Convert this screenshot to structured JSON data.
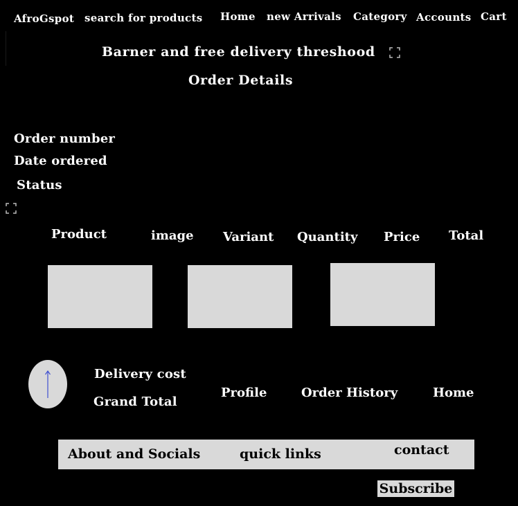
{
  "nav": {
    "logo": "AfroGspot",
    "search": "search for products",
    "items": [
      "Home",
      "new Arrivals",
      "Category",
      "Accounts",
      "Cart"
    ]
  },
  "banner": "Barner and free delivery threshood",
  "page_title": "Order Details",
  "order": {
    "number_label": "Order number",
    "date_label": "Date ordered",
    "status_label": "Status"
  },
  "table": {
    "headers": [
      "Product",
      "image",
      "Variant",
      "Quantity",
      "Price",
      "Total"
    ]
  },
  "summary": {
    "delivery_label": "Delivery cost",
    "grand_total_label": "Grand Total"
  },
  "account_links": [
    "Profile",
    "Order History",
    "Home"
  ],
  "footer": {
    "about": "About and Socials",
    "quick_links": "quick links",
    "contact": "contact",
    "subscribe": "Subscribe"
  },
  "colors": {
    "background": "#000000",
    "text": "#ffffff",
    "placeholder": "#d9d9d9",
    "arrow": "#3f4fd0"
  }
}
